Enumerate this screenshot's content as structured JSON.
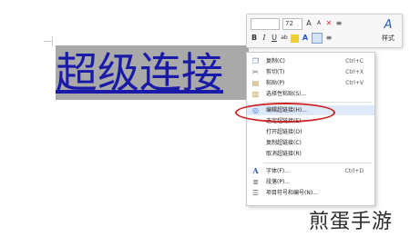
{
  "document": {
    "link_text": "超级连接"
  },
  "mini_toolbar": {
    "font_name": "",
    "font_size": "72",
    "grow_font_icon": "A",
    "shrink_font_icon": "A",
    "clear_format_icon": "✕",
    "list_icon": "≡",
    "bold": "B",
    "italic": "I",
    "underline": "U",
    "highlight_icon": "ab",
    "font_color_icon": "A",
    "styles_icon": "A",
    "styles_label": "样式"
  },
  "context_menu": {
    "items": [
      {
        "label": "复制(C)",
        "shortcut": "Ctrl+C",
        "icon": "copy-icon"
      },
      {
        "label": "剪切(T)",
        "shortcut": "Ctrl+X",
        "icon": "cut-icon"
      },
      {
        "label": "粘贴(P)",
        "shortcut": "Ctrl+V",
        "icon": "paste-icon"
      },
      {
        "label": "选择性粘贴(S)...",
        "shortcut": "",
        "icon": "paste-special-icon"
      },
      {
        "label": "编辑超链接(H)...",
        "shortcut": "",
        "icon": "hyperlink-icon"
      },
      {
        "label": "选定超链接(E)",
        "shortcut": "",
        "icon": ""
      },
      {
        "label": "打开超链接(O)",
        "shortcut": "",
        "icon": ""
      },
      {
        "label": "复制超链接(C)",
        "shortcut": "",
        "icon": ""
      },
      {
        "label": "取消超链接(R)",
        "shortcut": "",
        "icon": ""
      },
      {
        "label": "字体(F)...",
        "shortcut": "Ctrl+D",
        "icon": "font-icon"
      },
      {
        "label": "段落(P)...",
        "shortcut": "",
        "icon": "paragraph-icon"
      },
      {
        "label": "项目符号和编号(N)...",
        "shortcut": "",
        "icon": "bullets-icon"
      }
    ]
  },
  "watermark": "煎蛋手游",
  "colors": {
    "link": "#1a1aa8",
    "selection": "#a9a9a9",
    "highlight_oval": "#cc2222"
  }
}
